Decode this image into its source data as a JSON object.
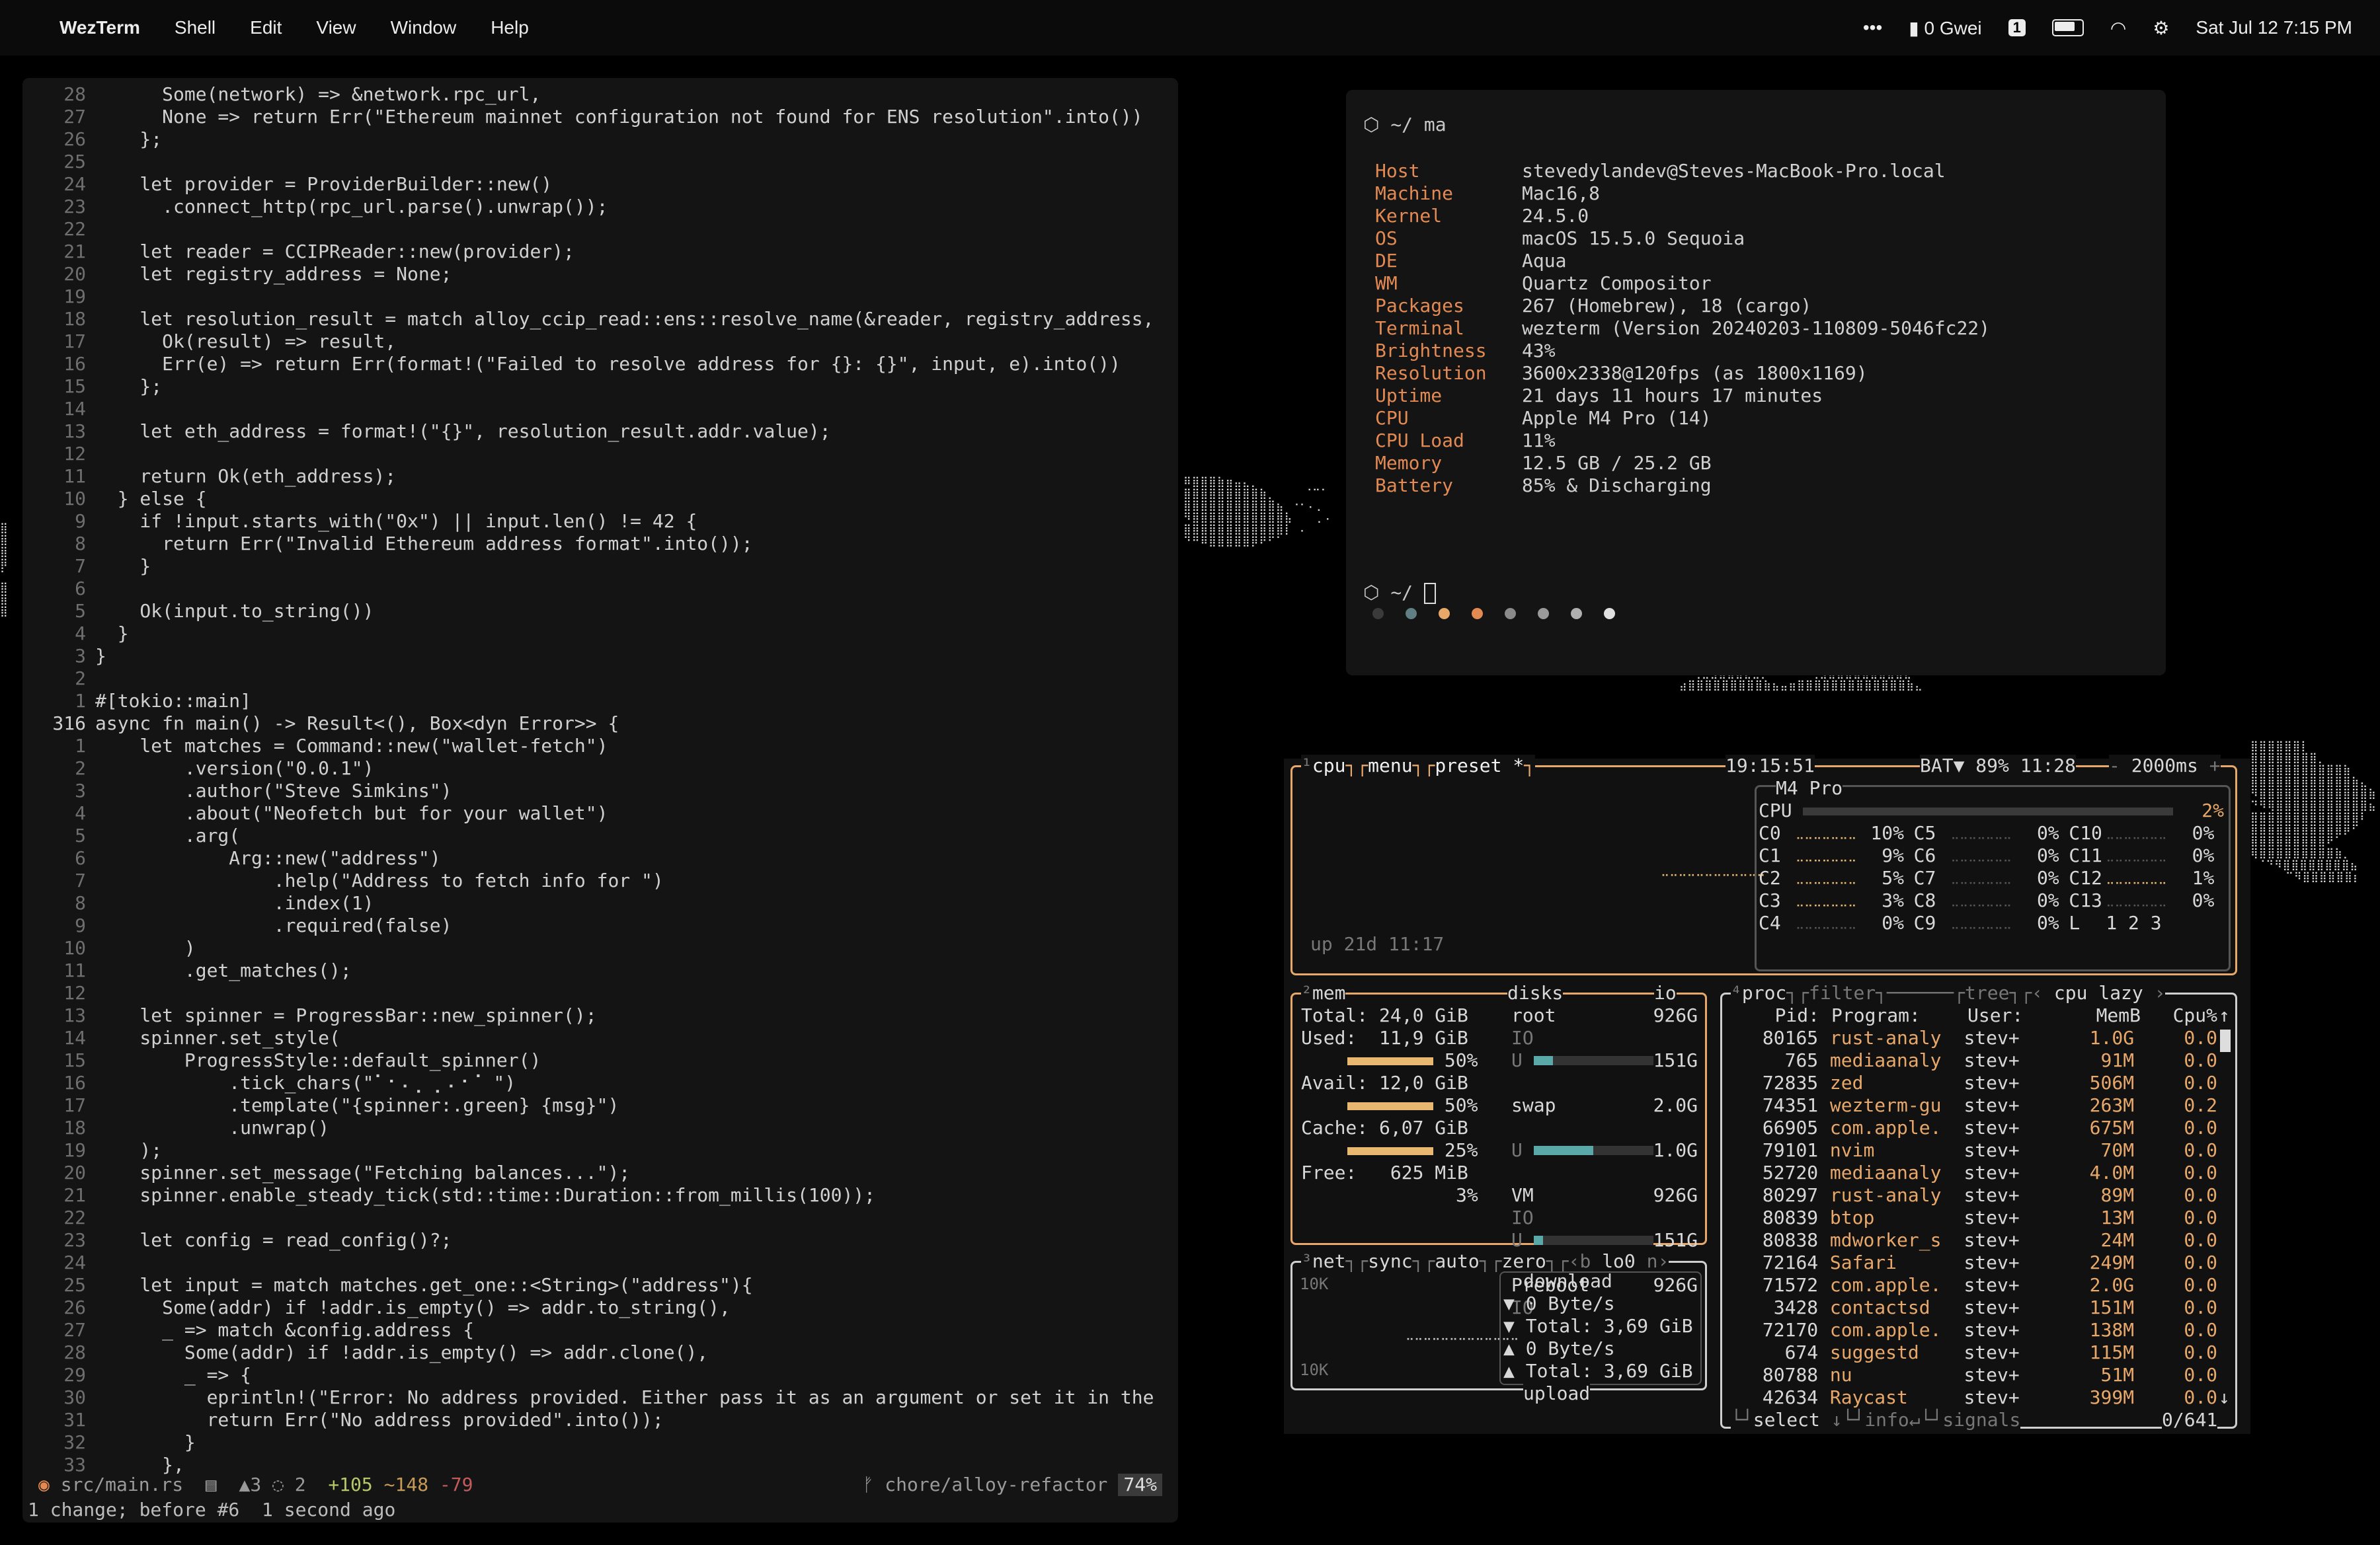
{
  "menubar": {
    "app": "WezTerm",
    "items": [
      "Shell",
      "Edit",
      "View",
      "Window",
      "Help"
    ],
    "gas": "0 Gwei",
    "space": "1",
    "datetime": "Sat Jul 12  7:15 PM"
  },
  "editor": {
    "lines": [
      {
        "n": "28",
        "t": "      Some(network) => &network.rpc_url,"
      },
      {
        "n": "27",
        "t": "      None => return Err(\"Ethereum mainnet configuration not found for ENS resolution\".into())"
      },
      {
        "n": "26",
        "t": "    };"
      },
      {
        "n": "25",
        "t": ""
      },
      {
        "n": "24",
        "t": "    let provider = ProviderBuilder::new()"
      },
      {
        "n": "23",
        "t": "      .connect_http(rpc_url.parse().unwrap());"
      },
      {
        "n": "22",
        "t": ""
      },
      {
        "n": "21",
        "t": "    let reader = CCIPReader::new(provider);"
      },
      {
        "n": "20",
        "t": "    let registry_address = None;"
      },
      {
        "n": "19",
        "t": ""
      },
      {
        "n": "18",
        "t": "    let resolution_result = match alloy_ccip_read::ens::resolve_name(&reader, registry_address,"
      },
      {
        "n": "17",
        "t": "      Ok(result) => result,"
      },
      {
        "n": "16",
        "t": "      Err(e) => return Err(format!(\"Failed to resolve address for {}: {}\", input, e).into())"
      },
      {
        "n": "15",
        "t": "    };"
      },
      {
        "n": "14",
        "t": ""
      },
      {
        "n": "13",
        "t": "    let eth_address = format!(\"{}\", resolution_result.addr.value);"
      },
      {
        "n": "12",
        "t": ""
      },
      {
        "n": "11",
        "t": "    return Ok(eth_address);"
      },
      {
        "n": "10",
        "t": "  } else {"
      },
      {
        "n": "9",
        "t": "    if !input.starts_with(\"0x\") || input.len() != 42 {"
      },
      {
        "n": "8",
        "t": "      return Err(\"Invalid Ethereum address format\".into());"
      },
      {
        "n": "7",
        "t": "    }"
      },
      {
        "n": "6",
        "t": ""
      },
      {
        "n": "5",
        "t": "    Ok(input.to_string())"
      },
      {
        "n": "4",
        "t": "  }"
      },
      {
        "n": "3",
        "t": "}"
      },
      {
        "n": "2",
        "t": ""
      },
      {
        "n": "1",
        "t": "#[tokio::main]"
      },
      {
        "n": "316",
        "t": "async fn main() -> Result<(), Box<dyn Error>> {"
      },
      {
        "n": "1",
        "t": "    let matches = Command::new(\"wallet-fetch\")"
      },
      {
        "n": "2",
        "t": "        .version(\"0.0.1\")"
      },
      {
        "n": "3",
        "t": "        .author(\"Steve Simkins\")"
      },
      {
        "n": "4",
        "t": "        .about(\"Neofetch but for your wallet\")"
      },
      {
        "n": "5",
        "t": "        .arg("
      },
      {
        "n": "6",
        "t": "            Arg::new(\"address\")"
      },
      {
        "n": "7",
        "t": "                .help(\"Address to fetch info for \")"
      },
      {
        "n": "8",
        "t": "                .index(1)"
      },
      {
        "n": "9",
        "t": "                .required(false)"
      },
      {
        "n": "10",
        "t": "        )"
      },
      {
        "n": "11",
        "t": "        .get_matches();"
      },
      {
        "n": "12",
        "t": ""
      },
      {
        "n": "13",
        "t": "    let spinner = ProgressBar::new_spinner();"
      },
      {
        "n": "14",
        "t": "    spinner.set_style("
      },
      {
        "n": "15",
        "t": "        ProgressStyle::default_spinner()"
      },
      {
        "n": "16",
        "t": "            .tick_chars(\"⠁⠂⠄⡀⢀⠠⠐⠈ \")"
      },
      {
        "n": "17",
        "t": "            .template(\"{spinner:.green} {msg}\")"
      },
      {
        "n": "18",
        "t": "            .unwrap()"
      },
      {
        "n": "19",
        "t": "    );"
      },
      {
        "n": "20",
        "t": "    spinner.set_message(\"Fetching balances...\");"
      },
      {
        "n": "21",
        "t": "    spinner.enable_steady_tick(std::time::Duration::from_millis(100));"
      },
      {
        "n": "22",
        "t": ""
      },
      {
        "n": "23",
        "t": "    let config = read_config()?;"
      },
      {
        "n": "24",
        "t": ""
      },
      {
        "n": "25",
        "t": "    let input = match matches.get_one::<String>(\"address\"){"
      },
      {
        "n": "26",
        "t": "      Some(addr) if !addr.is_empty() => addr.to_string(),"
      },
      {
        "n": "27",
        "t": "      _ => match &config.address {"
      },
      {
        "n": "28",
        "t": "        Some(addr) if !addr.is_empty() => addr.clone(),"
      },
      {
        "n": "29",
        "t": "        _ => {"
      },
      {
        "n": "30",
        "t": "          eprintln!(\"Error: No address provided. Either pass it as an argument or set it in the"
      },
      {
        "n": "31",
        "t": "          return Err(\"No address provided\".into());"
      },
      {
        "n": "32",
        "t": "        }"
      },
      {
        "n": "33",
        "t": "      },"
      }
    ],
    "status": {
      "file": "src/main.rs",
      "warn": "3",
      "hint": "2",
      "added": "+105",
      "changed": "~148",
      "removed": "-79",
      "branch": "chore/alloy-refactor",
      "percent": "74%"
    },
    "cmdline": "1 change; before #6  1 second ago"
  },
  "fastfetch": {
    "prompt": "~/ ma",
    "rows": [
      {
        "k": "Host",
        "v": "stevedylandev@Steves-MacBook-Pro.local"
      },
      {
        "k": "Machine",
        "v": "Mac16,8"
      },
      {
        "k": "Kernel",
        "v": "24.5.0"
      },
      {
        "k": "OS",
        "v": "macOS 15.5.0 Sequoia"
      },
      {
        "k": "DE",
        "v": "Aqua"
      },
      {
        "k": "WM",
        "v": "Quartz Compositor"
      },
      {
        "k": "Packages",
        "v": "267 (Homebrew), 18 (cargo)"
      },
      {
        "k": "Terminal",
        "v": "wezterm (Version 20240203-110809-5046fc22)"
      },
      {
        "k": "Brightness",
        "v": "43%"
      },
      {
        "k": "Resolution",
        "v": "3600x2338@120fps (as 1800x1169)"
      },
      {
        "k": "Uptime",
        "v": "21 days 11 hours 17 minutes"
      },
      {
        "k": "CPU",
        "v": "Apple M4 Pro (14)"
      },
      {
        "k": "CPU Load",
        "v": "11%"
      },
      {
        "k": "Memory",
        "v": "12.5 GB / 25.2 GB"
      },
      {
        "k": "Battery",
        "v": "85% & Discharging"
      }
    ],
    "palette": [
      "#3a3a3a",
      "#5f7f84",
      "#e8a86a",
      "#e38a53",
      "#8a8a8a",
      "#9a9a9a",
      "#b0b0b0",
      "#e0e0e0"
    ],
    "prompt2": "~/ "
  },
  "btop": {
    "cpu_header": {
      "label": "cpu",
      "menu": "menu",
      "preset": "preset *",
      "time": "19:15:51",
      "bat": "BAT▼ 89% 11:28",
      "interval": "2000ms"
    },
    "cpu_model": "M4 Pro",
    "cpu_total": "2%",
    "uptime": "up 21d 11:17",
    "cores": [
      [
        "C0",
        "10%",
        "C5",
        "0%",
        "C10",
        "0%"
      ],
      [
        "C1",
        "9%",
        "C6",
        "0%",
        "C11",
        "0%"
      ],
      [
        "C2",
        "5%",
        "C7",
        "0%",
        "C12",
        "1%"
      ],
      [
        "C3",
        "3%",
        "C8",
        "0%",
        "C13",
        "0%"
      ],
      [
        "C4",
        "0%",
        "C9",
        "0%",
        "L",
        "1 2 3"
      ]
    ],
    "mem": {
      "total": "Total: 24,0 GiB",
      "used": "Used:  11,9 GiB",
      "used_pct": "50%",
      "avail": "Avail: 12,0 GiB",
      "avail_pct": "50%",
      "cache": "Cache: 6,07 GiB",
      "cache_pct": "25%",
      "free": "Free:   625 MiB",
      "free_pct": "3%"
    },
    "disks": [
      {
        "name": "root",
        "size": "926G",
        "io": "IO",
        "used": "151G",
        "fill": 0.16
      },
      {
        "name": "swap",
        "size": "2.0G",
        "io": "",
        "used": "1.0G",
        "fill": 0.5
      },
      {
        "name": "VM",
        "size": "926G",
        "io": "IO",
        "used": "151G",
        "fill": 0.08
      },
      {
        "name": "Preboot",
        "size": "926G",
        "io": "IO",
        "used": "",
        "fill": 0
      }
    ],
    "net": {
      "label": "net",
      "sync": "sync",
      "auto": "auto",
      "zero": "zero",
      "iface": "lo0",
      "download": "download",
      "d_rate": "▼ 0 Byte/s",
      "d_total": "▼ Total: 3,69 GiB",
      "u_rate": "▲ 0 Byte/s",
      "u_total": "▲ Total: 3,69 GiB",
      "upload": "upload",
      "scale_top": "10K",
      "scale_bottom": "10K"
    },
    "proc": {
      "header": {
        "label": "proc",
        "filter": "filter",
        "tree": "tree",
        "sort": "cpu lazy"
      },
      "columns": [
        "Pid:",
        "Program:",
        "User:",
        "MemB",
        "Cpu%"
      ],
      "rows": [
        [
          "80165",
          "rust-analy",
          "stev+",
          "1.0G",
          "0.0"
        ],
        [
          "765",
          "mediaanaly",
          "stev+",
          "91M",
          "0.0"
        ],
        [
          "72835",
          "zed",
          "stev+",
          "506M",
          "0.0"
        ],
        [
          "74351",
          "wezterm-gu",
          "stev+",
          "263M",
          "0.2"
        ],
        [
          "66905",
          "com.apple.",
          "stev+",
          "675M",
          "0.0"
        ],
        [
          "79101",
          "nvim",
          "stev+",
          "70M",
          "0.0"
        ],
        [
          "52720",
          "mediaanaly",
          "stev+",
          "4.0M",
          "0.0"
        ],
        [
          "80297",
          "rust-analy",
          "stev+",
          "89M",
          "0.0"
        ],
        [
          "80839",
          "btop",
          "stev+",
          "13M",
          "0.0"
        ],
        [
          "80838",
          "mdworker_s",
          "stev+",
          "24M",
          "0.0"
        ],
        [
          "72164",
          "Safari",
          "stev+",
          "249M",
          "0.0"
        ],
        [
          "71572",
          "com.apple.",
          "stev+",
          "2.0G",
          "0.0"
        ],
        [
          "3428",
          "contactsd",
          "stev+",
          "151M",
          "0.0"
        ],
        [
          "72170",
          "com.apple.",
          "stev+",
          "138M",
          "0.0"
        ],
        [
          "674",
          "suggestd",
          "stev+",
          "115M",
          "0.0"
        ],
        [
          "80788",
          "nu",
          "stev+",
          "51M",
          "0.0"
        ],
        [
          "42634",
          "Raycast",
          "stev+",
          "399M",
          "0.0"
        ]
      ],
      "footer": {
        "select": "select",
        "info": "info",
        "signals": "signals",
        "count": "0/641"
      }
    }
  }
}
